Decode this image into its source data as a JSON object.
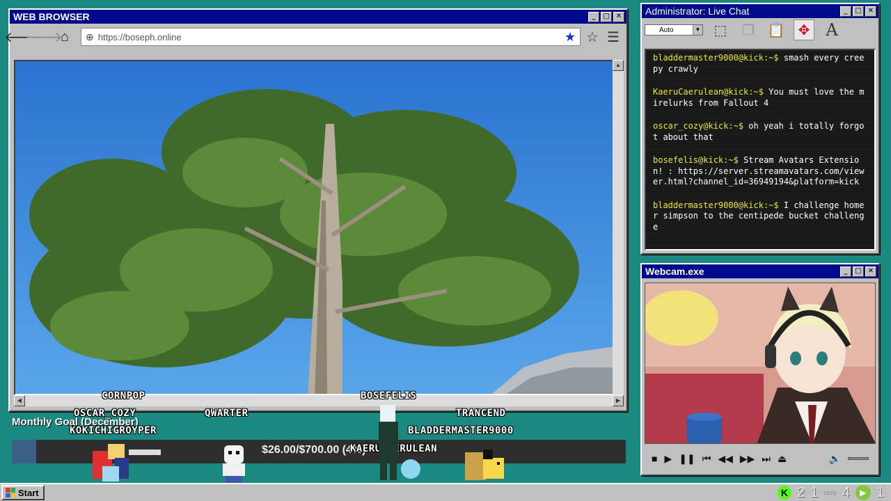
{
  "browser": {
    "title": "WEB BROWSER",
    "url": "https://boseph.online",
    "icons": [
      "back-arrow-icon",
      "forward-arrow-icon",
      "home-icon",
      "globe-icon",
      "bookmark-star-icon",
      "star-icon",
      "menu-icon"
    ]
  },
  "chat": {
    "title": "Administrator: Live Chat",
    "font_select": "Auto",
    "messages": [
      {
        "user": "bladdermaster9000@kick:~$",
        "text": " smash every creepy crawly"
      },
      {
        "user": "KaeruCaerulean@kick:~$",
        "text": " You must love the mirelurks from Fallout 4"
      },
      {
        "user": "oscar_cozy@kick:~$",
        "text": " oh yeah i totally forgot about that"
      },
      {
        "user": "bosefelis@kick:~$",
        "text": " Stream Avatars Extension! : https://server.streamavatars.com/viewer.html?channel_id=36949194&platform=kick"
      },
      {
        "user": "bladdermaster9000@kick:~$",
        "text": " I challenge homer simpson to the centipede bucket challenge"
      }
    ]
  },
  "webcam": {
    "title": "Webcam.exe"
  },
  "goal": {
    "label": "Monthly Goal (December)",
    "amount": "$26.00/$700.00 (4%)",
    "progress": 0.04
  },
  "avatars": {
    "cornpop": "CORNPOP",
    "oscar": "OSCAR_COZY",
    "kokichi": "KOKICHIGROYPER",
    "qwarter": "QWARTER",
    "bosefelis": "BOSEFELIS",
    "trancend": "TRANCEND",
    "bladder": "BLADDERMASTER9000",
    "kaeru": "KAERUCAERULEAN"
  },
  "taskbar": {
    "start": "Start",
    "kick_count": "2",
    "num2": "1",
    "cozy": "cozy",
    "num3": "4",
    "rumble_count": "1"
  },
  "colors": {
    "desktop": "#1a8a80",
    "titlebar": "#000a8a",
    "chat_user": "#e8e830",
    "kick_green": "#53fc18"
  }
}
